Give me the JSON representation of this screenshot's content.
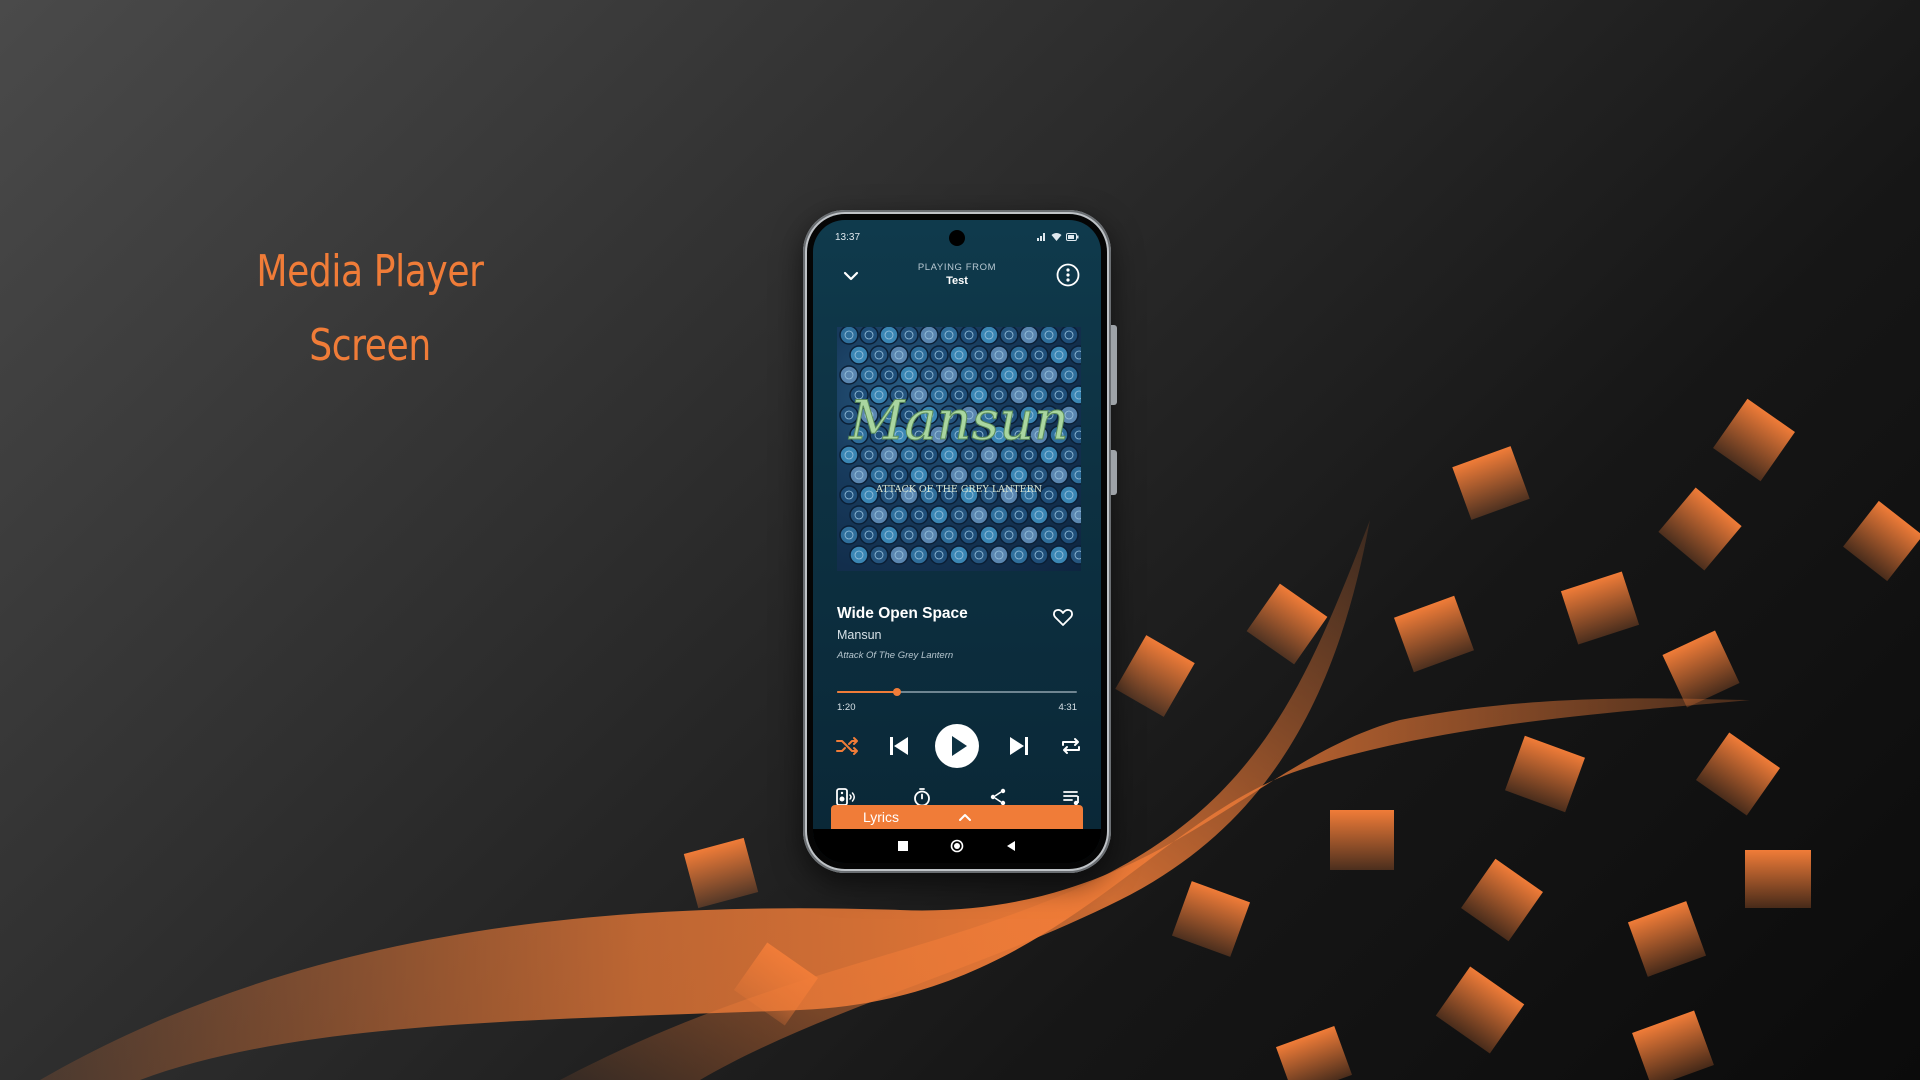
{
  "headline": {
    "line1": "Media Player",
    "line2": "Screen"
  },
  "colors": {
    "accent": "#f07c38",
    "screen_bg": "#0d3142"
  },
  "status_bar": {
    "time": "13:37",
    "icons": [
      "signal-icon",
      "wifi-icon",
      "battery-icon"
    ]
  },
  "header": {
    "playing_from_label": "PLAYING FROM",
    "source_name": "Test",
    "collapse_icon": "chevron-down-icon",
    "menu_icon": "more-vertical-icon"
  },
  "album_art": {
    "band_text": "Mansun",
    "album_text": "ATTACK OF THE GREY LANTERN"
  },
  "track": {
    "title": "Wide Open Space",
    "artist": "Mansun",
    "album": "Attack Of The Grey Lantern",
    "favorite_icon": "heart-outline-icon"
  },
  "playback": {
    "current_time": "1:20",
    "total_time": "4:31",
    "progress_fraction": 0.25
  },
  "controls": [
    "shuffle-icon",
    "skip-previous-icon",
    "play-icon",
    "skip-next-icon",
    "repeat-icon"
  ],
  "extras": [
    "speaker-icon",
    "sleep-timer-icon",
    "share-icon",
    "queue-icon"
  ],
  "lyrics": {
    "label": "Lyrics",
    "icon": "chevron-up-icon"
  },
  "nav": [
    "recents-icon",
    "home-icon",
    "back-icon"
  ]
}
